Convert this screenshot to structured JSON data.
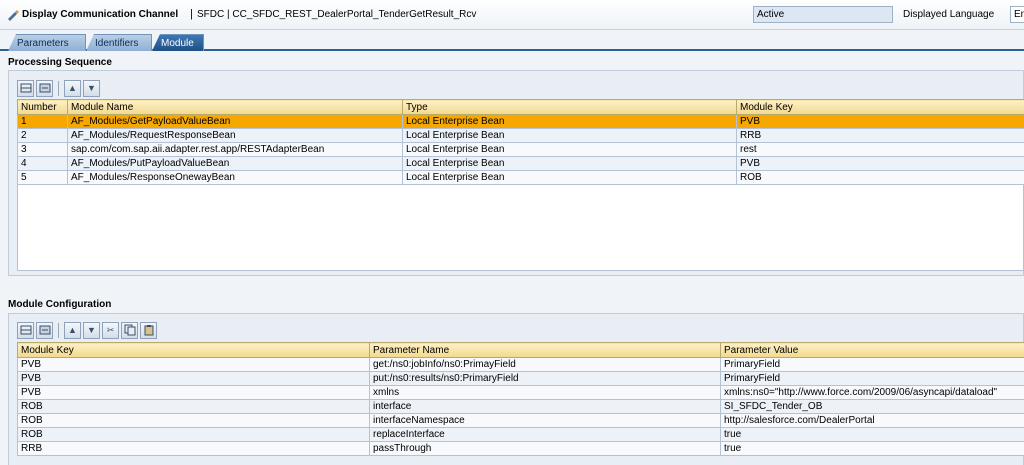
{
  "titlebar": {
    "title": "Display Communication Channel",
    "separator": "|",
    "object_path": "SFDC | CC_SFDC_REST_DealerPortal_TenderGetResult_Rcv",
    "status_value": "Active",
    "language_label": "Displayed Language",
    "language_value": "En"
  },
  "tabs": [
    {
      "label": "Parameters"
    },
    {
      "label": "Identifiers"
    },
    {
      "label": "Module"
    }
  ],
  "processing": {
    "title": "Processing Sequence",
    "columns": [
      "Number",
      "Module Name",
      "Type",
      "Module Key"
    ],
    "rows": [
      {
        "number": "1",
        "name": "AF_Modules/GetPayloadValueBean",
        "type": "Local Enterprise Bean",
        "key": "PVB"
      },
      {
        "number": "2",
        "name": "AF_Modules/RequestResponseBean",
        "type": "Local Enterprise Bean",
        "key": "RRB"
      },
      {
        "number": "3",
        "name": "sap.com/com.sap.aii.adapter.rest.app/RESTAdapterBean",
        "type": "Local Enterprise Bean",
        "key": "rest"
      },
      {
        "number": "4",
        "name": "AF_Modules/PutPayloadValueBean",
        "type": "Local Enterprise Bean",
        "key": "PVB"
      },
      {
        "number": "5",
        "name": "AF_Modules/ResponseOnewayBean",
        "type": "Local Enterprise Bean",
        "key": "ROB"
      }
    ]
  },
  "config": {
    "title": "Module Configuration",
    "columns": [
      "Module Key",
      "Parameter Name",
      "Parameter Value"
    ],
    "rows": [
      {
        "key": "PVB",
        "name": "get:/ns0:jobInfo/ns0:PrimayField",
        "value": "PrimaryField"
      },
      {
        "key": "PVB",
        "name": "put:/ns0:results/ns0:PrimaryField",
        "value": "PrimaryField"
      },
      {
        "key": "PVB",
        "name": "xmlns",
        "value": "xmlns:ns0=\"http://www.force.com/2009/06/asyncapi/dataload\""
      },
      {
        "key": "ROB",
        "name": "interface",
        "value": "SI_SFDC_Tender_OB"
      },
      {
        "key": "ROB",
        "name": "interfaceNamespace",
        "value": "http://salesforce.com/DealerPortal"
      },
      {
        "key": "ROB",
        "name": "replaceInterface",
        "value": "true"
      },
      {
        "key": "RRB",
        "name": "passThrough",
        "value": "true"
      }
    ]
  }
}
